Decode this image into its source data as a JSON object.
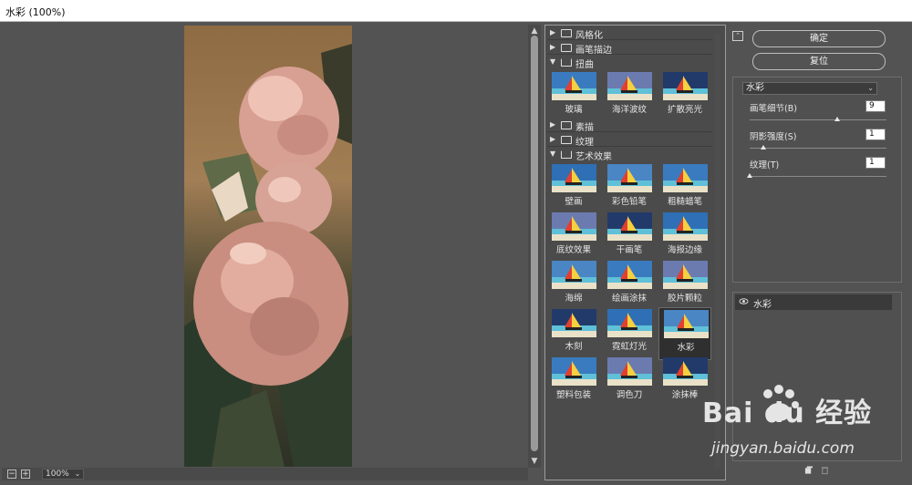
{
  "window": {
    "title": "水彩 (100%)"
  },
  "zoom": {
    "value": "100%",
    "zoom_out": "−",
    "zoom_in": "+"
  },
  "gallery": {
    "folders": [
      {
        "label": "风格化",
        "expanded": false
      },
      {
        "label": "画笔描边",
        "expanded": false
      },
      {
        "label": "扭曲",
        "expanded": true,
        "items": [
          "玻璃",
          "海洋波纹",
          "扩散亮光"
        ]
      },
      {
        "label": "素描",
        "expanded": false
      },
      {
        "label": "纹理",
        "expanded": false
      },
      {
        "label": "艺术效果",
        "expanded": true,
        "items": [
          "壁画",
          "彩色铅笔",
          "粗糙蜡笔",
          "底纹效果",
          "干画笔",
          "海报边缘",
          "海绵",
          "绘画涂抹",
          "胶片颗粒",
          "木刻",
          "霓虹灯光",
          "水彩",
          "塑料包装",
          "调色刀",
          "涂抹棒"
        ]
      }
    ],
    "selected": "水彩"
  },
  "buttons": {
    "ok": "确定",
    "reset": "复位"
  },
  "settings": {
    "filter": "水彩",
    "params": [
      {
        "label": "画笔细节(B)",
        "value": "9",
        "fraction": 0.64
      },
      {
        "label": "阴影强度(S)",
        "value": "1",
        "fraction": 0.1
      },
      {
        "label": "纹理(T)",
        "value": "1",
        "fraction": 0.0
      }
    ]
  },
  "layers": [
    {
      "name": "水彩",
      "visible": true
    }
  ],
  "watermark": {
    "brand": "Bai du 经验",
    "url": "jingyan.baidu.com"
  },
  "colors": {
    "panel": "#535353",
    "selection": "#2f2f2f",
    "title_bg": "#ffffff"
  }
}
